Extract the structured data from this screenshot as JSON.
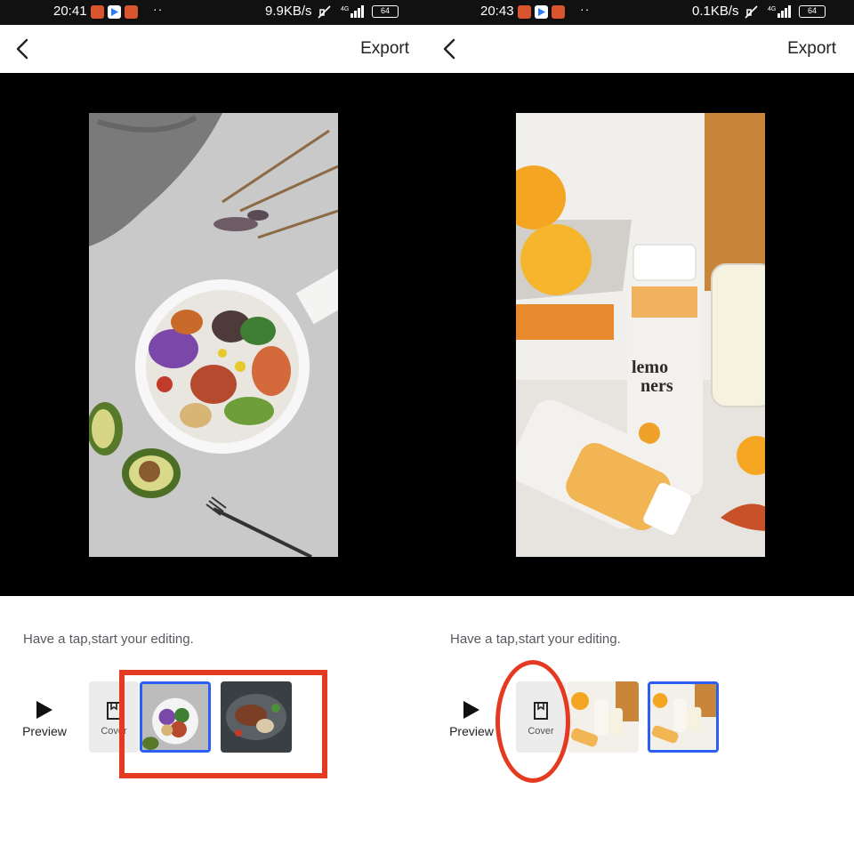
{
  "left_screen": {
    "status_bar": {
      "time": "20:41",
      "network_speed": "9.9KB/s",
      "network_type": "4G",
      "battery": "64",
      "more_dots": "··"
    },
    "header": {
      "back_icon": "chevron-left-icon",
      "export_label": "Export"
    },
    "hint": "Have a tap,start your editing.",
    "timeline": {
      "preview_label": "Preview",
      "cover_label": "Cover",
      "clips": [
        {
          "subject": "salad bowl",
          "selected": true
        },
        {
          "subject": "grilled steak platter",
          "selected": false
        }
      ]
    }
  },
  "right_screen": {
    "status_bar": {
      "time": "20:43",
      "network_speed": "0.1KB/s",
      "network_type": "4G",
      "battery": "64",
      "more_dots": "··"
    },
    "header": {
      "back_icon": "chevron-left-icon",
      "export_label": "Export"
    },
    "preview_image_text": [
      "lemo",
      "ners"
    ],
    "hint": "Have a tap,start your editing.",
    "timeline": {
      "preview_label": "Preview",
      "cover_label": "Cover",
      "clips": [
        {
          "subject": "lemon juice bottles",
          "selected": false
        },
        {
          "subject": "lemon juice bottles",
          "selected": true
        }
      ]
    }
  },
  "colors": {
    "accent_selected": "#2b5ef5",
    "annotation_red": "#e53a22",
    "status_bar_bg": "#111111",
    "preview_bg": "#000000"
  }
}
